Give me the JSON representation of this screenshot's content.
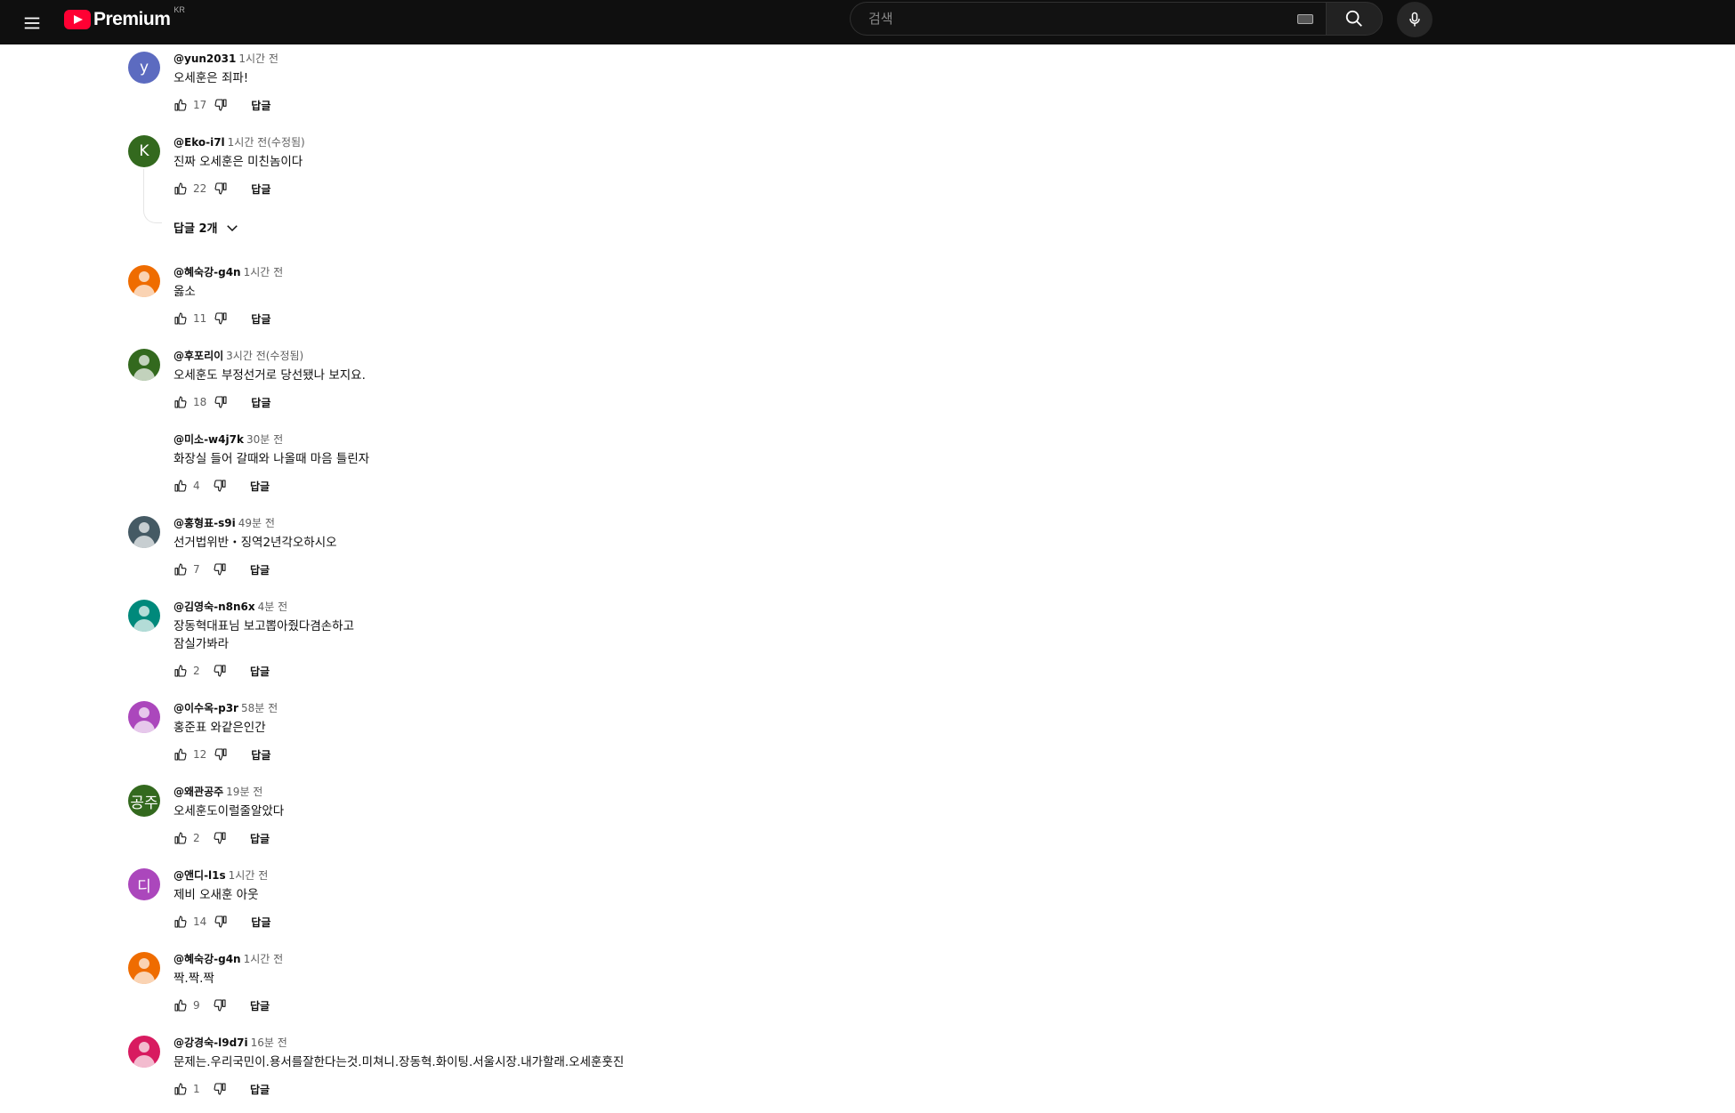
{
  "header": {
    "logo_text": "Premium",
    "country": "KR",
    "search_placeholder": "검색"
  },
  "colors": {
    "topbar": "#0f0f0f",
    "brand_red": "#ff0033"
  },
  "replies_toggle": {
    "label": "답글 2개"
  },
  "comments": [
    {
      "author": "@yun2031",
      "time": "1시간 전",
      "text": "오세훈은 죄파!",
      "likes": "17",
      "reply": "답글",
      "avatar_letter": "y",
      "avatar_color": "#5c6bc0"
    },
    {
      "author": "@Eko-i7l",
      "time": "1시간 전(수정됨)",
      "text": "진짜  오세훈은 미친놈이다",
      "likes": "22",
      "reply": "답글",
      "avatar_letter": "K",
      "avatar_color": "#33691e"
    },
    {
      "author": "@혜숙강-g4n",
      "time": "1시간 전",
      "text": "옳소",
      "likes": "11",
      "reply": "답글",
      "avatar_letter": "",
      "avatar_color": "#ef6c00"
    },
    {
      "author": "@후포리이",
      "time": "3시간 전(수정됨)",
      "text": "오세훈도  부정선거로  당선됐나  보지요.",
      "likes": "18",
      "reply": "답글",
      "avatar_letter": "",
      "avatar_color": "#33691e"
    },
    {
      "author": "@미소-w4j7k",
      "time": "30분 전",
      "text": "화장실 들어 갈때와 나올때 마음 틀린자",
      "likes": "4",
      "reply": "답글",
      "avatar_letter": "",
      "avatar_color": ""
    },
    {
      "author": "@홍형표-s9i",
      "time": "49분 전",
      "text": "선거법위반・징역2년각오하시오",
      "likes": "7",
      "reply": "답글",
      "avatar_letter": "",
      "avatar_color": "#455a64"
    },
    {
      "author": "@김영숙-n8n6x",
      "time": "4분 전",
      "text": "장동혁대표님 보고뽑아줬다겸손하고\n잠실가봐라",
      "likes": "2",
      "reply": "답글",
      "avatar_letter": "",
      "avatar_color": "#00897b"
    },
    {
      "author": "@이수옥-p3r",
      "time": "58분 전",
      "text": "홍준표 와같은인간",
      "likes": "12",
      "reply": "답글",
      "avatar_letter": "",
      "avatar_color": "#ab47bc"
    },
    {
      "author": "@왜관공주",
      "time": "19분 전",
      "text": "오세훈도이럴줄알았다",
      "likes": "2",
      "reply": "답글",
      "avatar_letter": "공주",
      "avatar_color": "#33691e"
    },
    {
      "author": "@앤디-l1s",
      "time": "1시간 전",
      "text": "제비 오새훈 아웃",
      "likes": "14",
      "reply": "답글",
      "avatar_letter": "디",
      "avatar_color": "#ab47bc"
    },
    {
      "author": "@혜숙강-g4n",
      "time": "1시간 전",
      "text": "짝.짝.짝",
      "likes": "9",
      "reply": "답글",
      "avatar_letter": "",
      "avatar_color": "#ef6c00"
    },
    {
      "author": "@강경숙-l9d7i",
      "time": "16분 전",
      "text": "문제는.우리국민이.용서를잘한다는것.미쳐니.장동혁.화이팅.서울시장.내가할래.오세훈훗진",
      "likes": "1",
      "reply": "답글",
      "avatar_letter": "",
      "avatar_color": "#d81b60"
    }
  ]
}
